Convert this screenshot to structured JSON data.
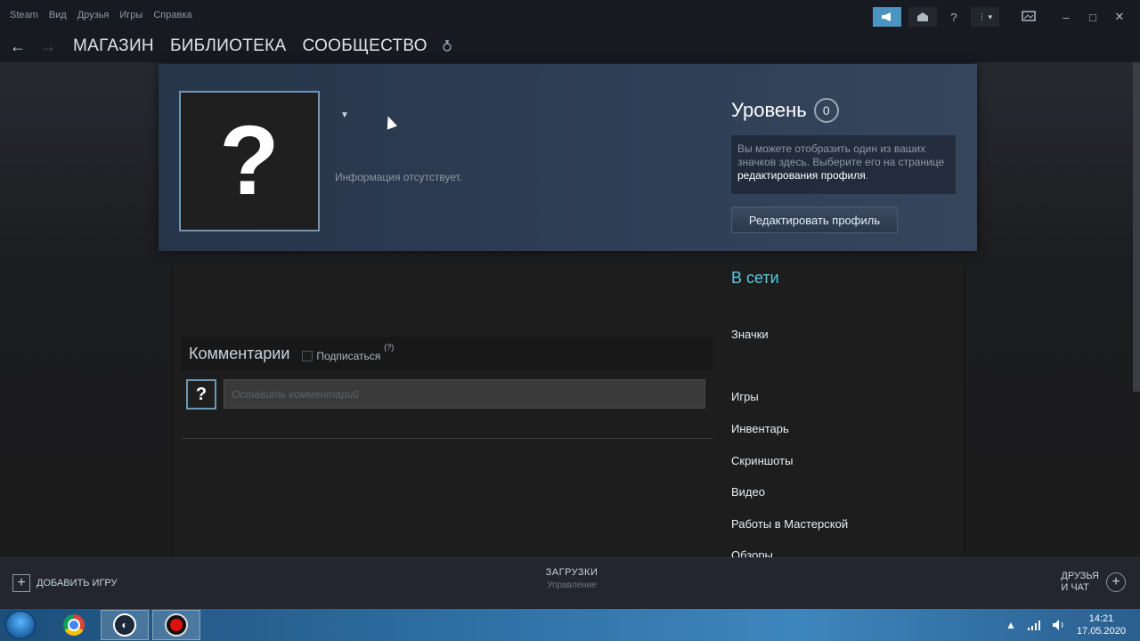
{
  "menu": {
    "items": [
      "Steam",
      "Вид",
      "Друзья",
      "Игры",
      "Справка"
    ]
  },
  "window": {
    "buttons": [
      "megaphone-icon",
      "envelope-icon",
      "help-icon",
      "account-menu",
      "screen-icon",
      "minimize",
      "maximize",
      "close"
    ],
    "help_label": "?",
    "minimize": "–",
    "maximize": "□",
    "close": "✕"
  },
  "nav": {
    "back": "←",
    "forward": "→",
    "links": [
      "МАГАЗИН",
      "БИБЛИОТЕКА",
      "СООБЩЕСТВО"
    ]
  },
  "profile": {
    "avatar_placeholder": "?",
    "no_info": "Информация отсутствует.",
    "level_label": "Уровень",
    "level_value": "0",
    "badge_hint_part1": "Вы можете отобразить один из ваших значков здесь. Выберите его на странице ",
    "badge_hint_link": "редактирования профиля",
    "badge_hint_end": ".",
    "edit_button": "Редактировать профиль"
  },
  "comments": {
    "title": "Комментарии",
    "subscribe_label": "Подписаться",
    "help_mark": "(?)",
    "input_placeholder": "Оставить комментарий",
    "mini_avatar": "?"
  },
  "sidebar": {
    "status": "В сети",
    "links": [
      "Значки",
      "Игры",
      "Инвентарь",
      "Скриншоты",
      "Видео",
      "Работы в Мастерской",
      "Обзоры"
    ]
  },
  "bottom": {
    "add_game": "ДОБАВИТЬ ИГРУ",
    "downloads": "ЗАГРУЗКИ",
    "downloads_sub": "Управление",
    "friends_line1": "ДРУЗЬЯ",
    "friends_line2": "И ЧАТ"
  },
  "taskbar": {
    "time": "14:21",
    "date": "17.05.2020"
  },
  "colors": {
    "accent_blue": "#4a94bf",
    "online_status": "#57cbde",
    "avatar_border": "#6d97b5"
  }
}
